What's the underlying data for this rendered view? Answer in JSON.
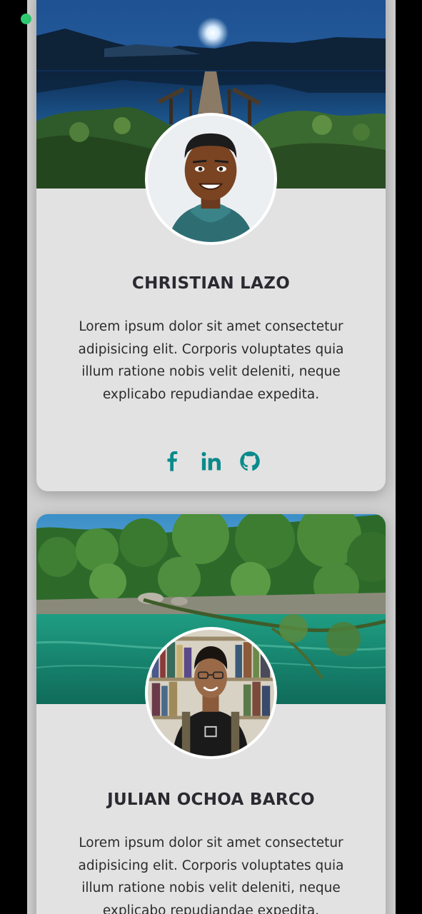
{
  "theme": {
    "accent": "#0b8a8a",
    "card_bg": "#e2e2e2",
    "name_color": "#2a2a30",
    "status_dot": "#2ecc71"
  },
  "profiles": [
    {
      "name": "CHRISTIAN LAZO",
      "bio": "Lorem ipsum dolor sit amet consectetur adipisicing elit. Corporis voluptates quia illum ratione nobis velit deleniti, neque explicabo repudiandae expedita.",
      "cover": "night-lake-pier-image",
      "avatar": "cartoon-avatar-image",
      "socials": [
        "facebook-icon",
        "linkedin-icon",
        "github-icon"
      ]
    },
    {
      "name": "JULIAN OCHOA BARCO",
      "bio": "Lorem ipsum dolor sit amet consectetur adipisicing elit. Corporis voluptates quia illum ratione nobis velit deleniti, neque explicabo repudiandae expedita.",
      "cover": "jungle-river-image",
      "avatar": "library-portrait-image"
    }
  ]
}
